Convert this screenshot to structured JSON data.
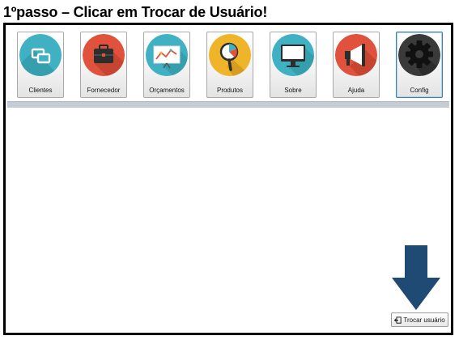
{
  "step_title": "1ºpasso – Clicar em Trocar de Usuário!",
  "toolbar": {
    "items": [
      {
        "label": "Clientes",
        "icon": "clients-icon",
        "color": "#3fb1c2"
      },
      {
        "label": "Fornecedor",
        "icon": "briefcase-icon",
        "color": "#e0523c"
      },
      {
        "label": "Orçamentos",
        "icon": "presentation-board-icon",
        "color": "#3fb1c2"
      },
      {
        "label": "Produtos",
        "icon": "magnifier-icon",
        "color": "#f0b42a"
      },
      {
        "label": "Sobre",
        "icon": "monitor-icon",
        "color": "#3fb1c2"
      },
      {
        "label": "Ajuda",
        "icon": "megaphone-icon",
        "color": "#e0523c"
      },
      {
        "label": "Config",
        "icon": "gear-icon",
        "color": "#3a3a3a"
      }
    ],
    "active_item": "Config"
  },
  "footer": {
    "swap_user_label": "Trocar usuário"
  },
  "annotation": {
    "arrow_color": "#1f4a73"
  }
}
